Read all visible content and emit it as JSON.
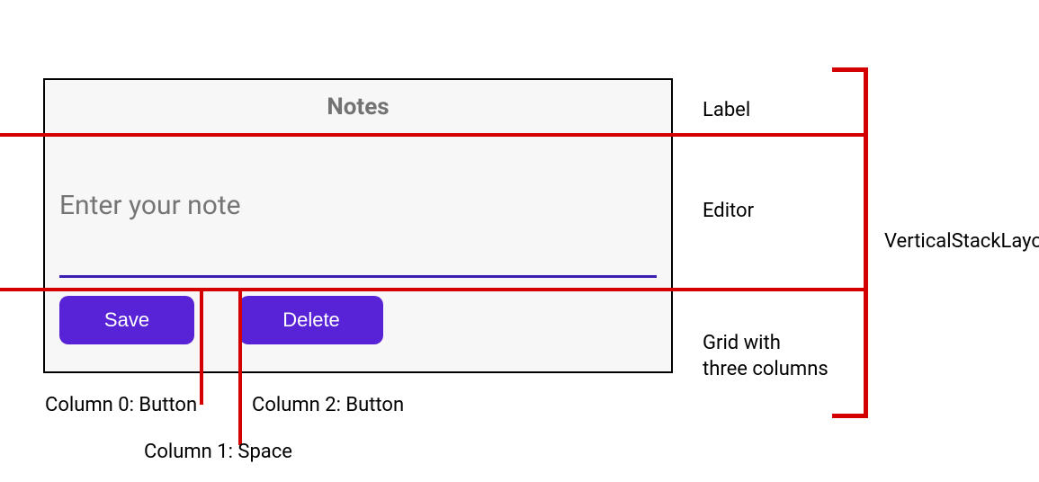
{
  "app": {
    "title": "Notes",
    "editor_placeholder": "Enter your note",
    "save_label": "Save",
    "delete_label": "Delete"
  },
  "annotations": {
    "label": "Label",
    "editor": "Editor",
    "grid": "Grid with\nthree columns",
    "stack": "VerticalStackLayout",
    "col0": "Column 0: Button",
    "col1": "Column 1: Space",
    "col2": "Column 2: Button"
  }
}
